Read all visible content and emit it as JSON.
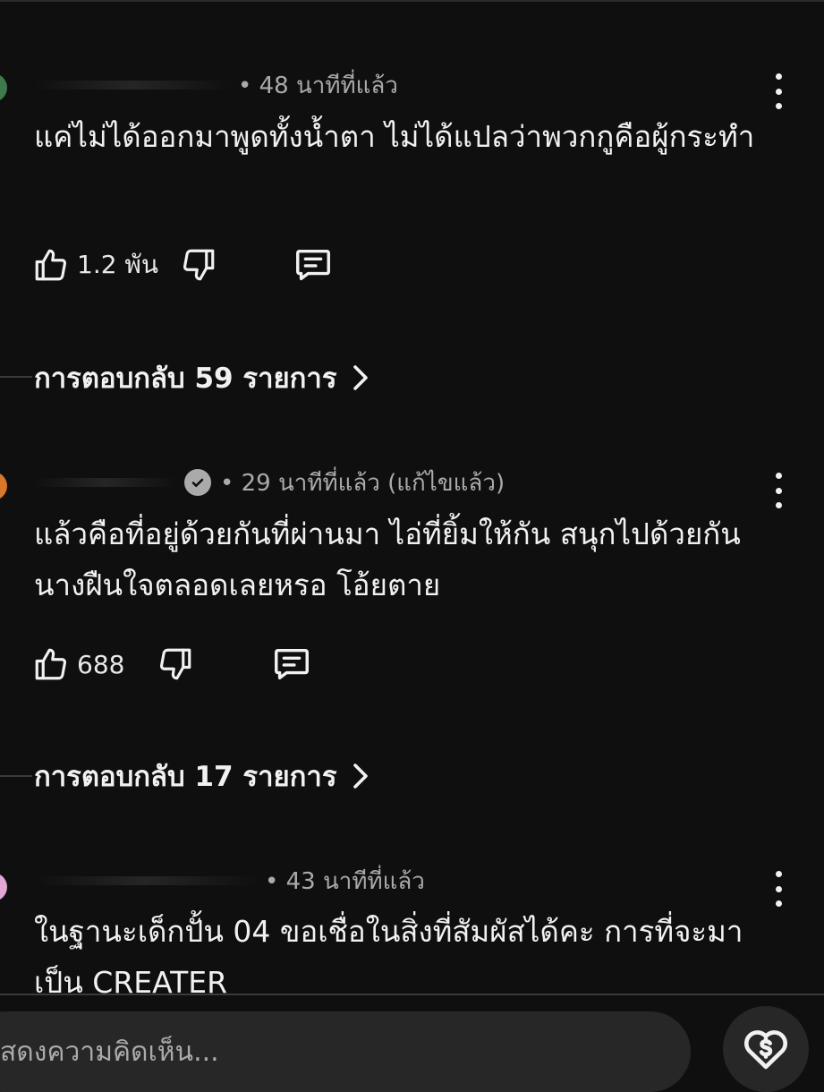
{
  "comments": [
    {
      "time": "• 48 นาทีที่แล้ว",
      "text": "แค่ไม่ได้ออกมาพูดทั้งน้ำตา ไม่ได้แปลว่าพวกกูคือผู้กระทำ",
      "likes": "1.2 พัน",
      "replies_label": "การตอบกลับ 59 รายการ",
      "avatar_color": "#3f7a4a"
    },
    {
      "time": "• 29 นาทีที่แล้ว (แก้ไขแล้ว)",
      "text": "แล้วคือที่อยู่ด้วยกันที่ผ่านมา ไอ่ที่ยิ้มให้กัน สนุกไปด้วยกัน นางฝืนใจตลอดเลยหรอ โอ้ยตาย",
      "likes": "688",
      "replies_label": "การตอบกลับ 17 รายการ",
      "avatar_color": "#d9772b"
    },
    {
      "time": "• 43 นาทีที่แล้ว",
      "text": "ในฐานะเด็กปั้น 04 ขอเชื่อในสิ่งที่สัมผัสได้คะ การที่จะมาเป็น CREATER",
      "avatar_color": "#e0a7d6"
    }
  ],
  "comment_input": {
    "placeholder": "สดงความคิดเห็น..."
  },
  "icons": {
    "like": "thumb-up-icon",
    "dislike": "thumb-down-icon",
    "reply": "reply-comment-icon",
    "more": "more-vert-icon",
    "verified": "verified-check-icon",
    "thanks": "super-thanks-icon"
  },
  "colors": {
    "background": "#0f0f0f",
    "text": "#f1f1f1",
    "secondary_text": "#aaaaaa",
    "input_bg": "#272727"
  }
}
